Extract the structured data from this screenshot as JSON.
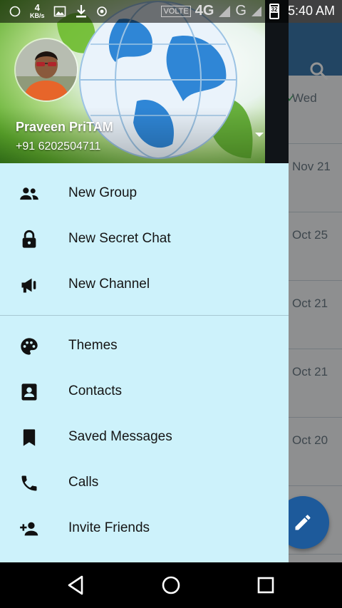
{
  "status_bar": {
    "speed_value": "4",
    "speed_unit": "KB/s",
    "volte": "VOLTE",
    "network_4g": "4G",
    "network_g": "G",
    "battery": "32",
    "time": "5:40 AM"
  },
  "drawer": {
    "user_name": "Praveen PriTAM",
    "user_phone": "+91 6202504711",
    "menu_primary": [
      {
        "label": "New Group",
        "icon": "group-icon"
      },
      {
        "label": "New Secret Chat",
        "icon": "lock-icon"
      },
      {
        "label": "New Channel",
        "icon": "megaphone-icon"
      }
    ],
    "menu_secondary": [
      {
        "label": "Themes",
        "icon": "palette-icon"
      },
      {
        "label": "Contacts",
        "icon": "contact-card-icon"
      },
      {
        "label": "Saved Messages",
        "icon": "bookmark-icon"
      },
      {
        "label": "Calls",
        "icon": "phone-icon"
      },
      {
        "label": "Invite Friends",
        "icon": "add-person-icon"
      }
    ]
  },
  "background_chats": {
    "dates": [
      "Wed",
      "Nov 21",
      "Oct 25",
      "Oct 21",
      "Oct 21",
      "Oct 20"
    ]
  },
  "colors": {
    "drawer_bg": "#cdf2fb",
    "toolbar": "#3b77ab",
    "fab": "#1d5a9b"
  }
}
